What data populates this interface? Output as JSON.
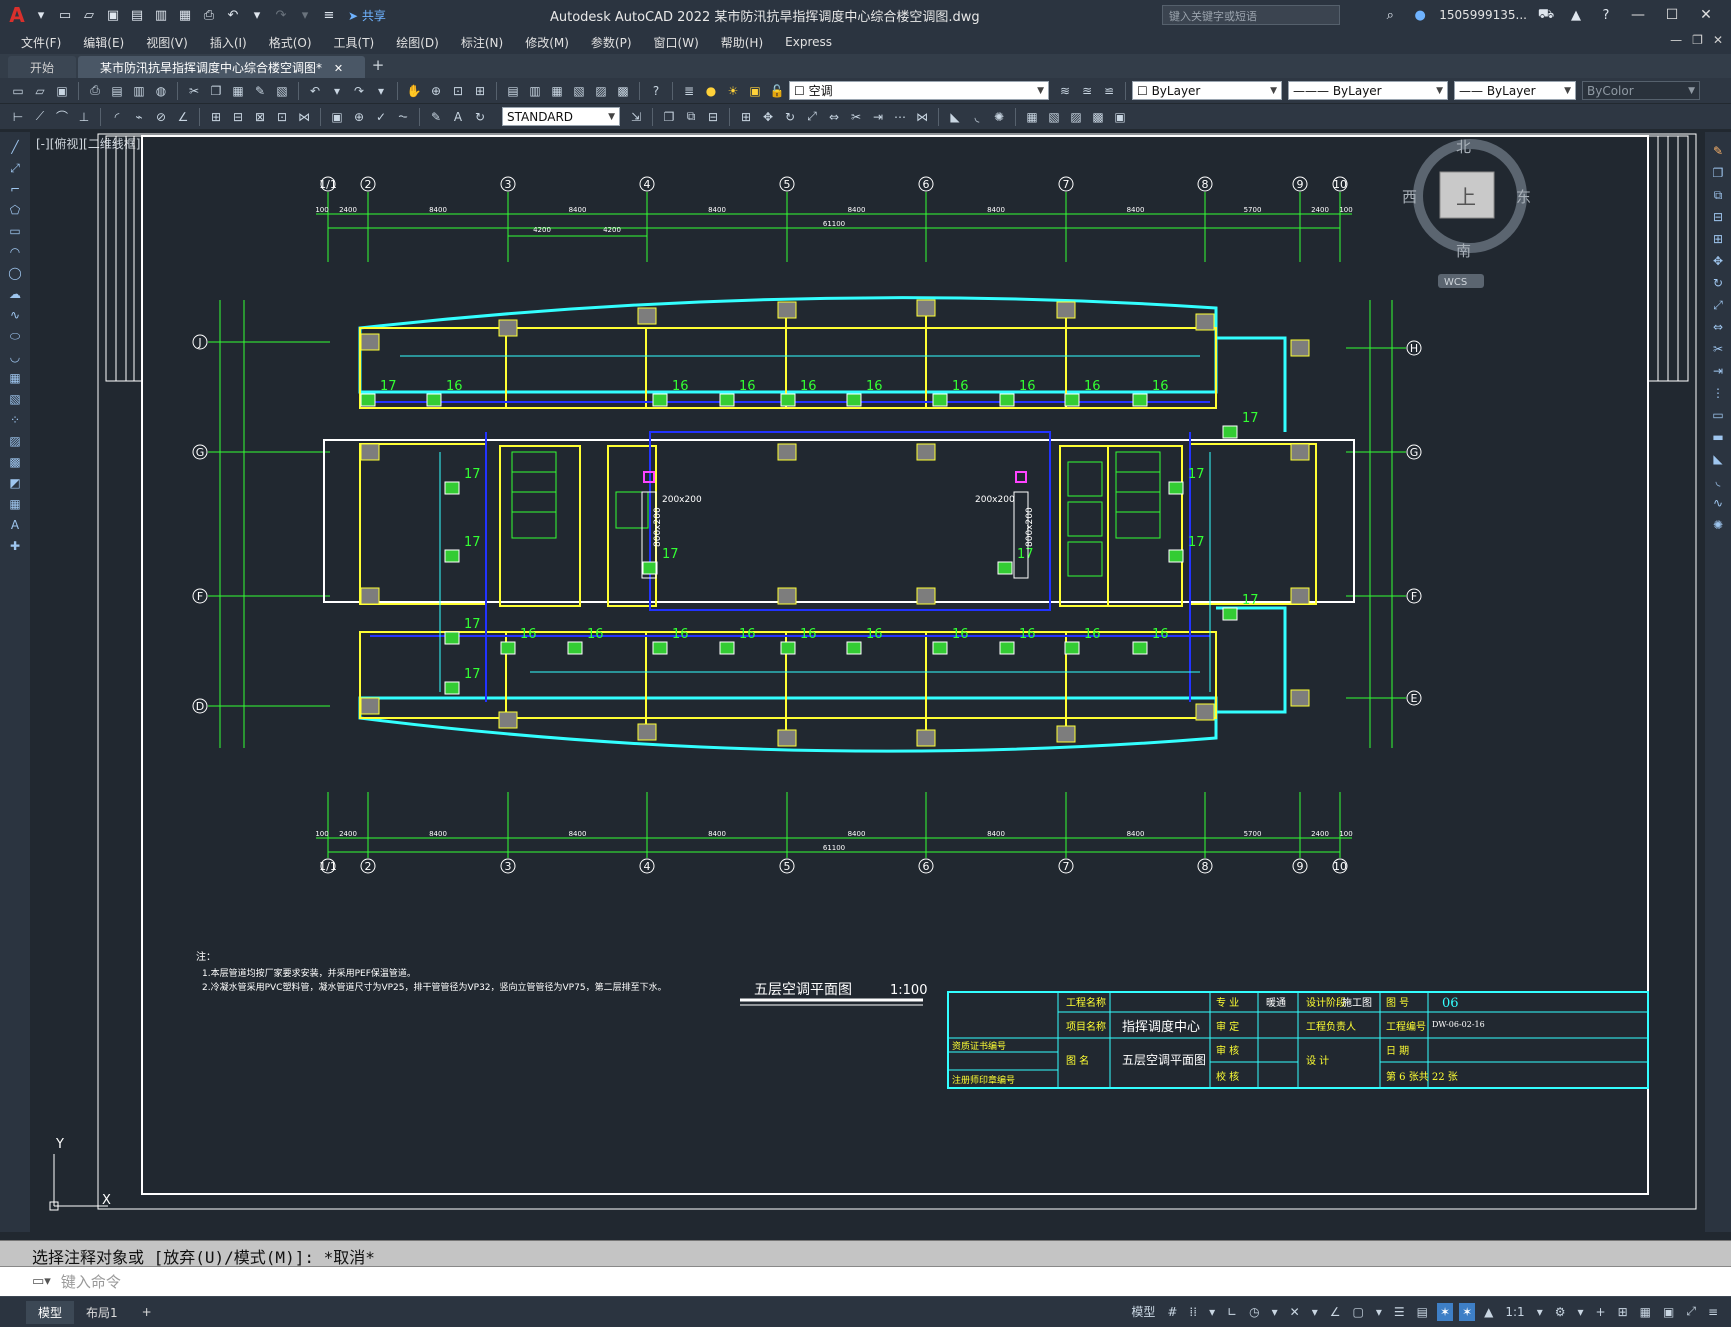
{
  "app": {
    "logo": "A",
    "title": "Autodesk AutoCAD 2022    某市防汛抗旱指挥调度中心综合楼空调图.dwg",
    "share": "共享",
    "search_placeholder": "键入关键字或短语",
    "user": "1505999135...",
    "minimize": "—",
    "maximize": "☐",
    "close": "✕"
  },
  "menu": [
    "文件(F)",
    "编辑(E)",
    "视图(V)",
    "插入(I)",
    "格式(O)",
    "工具(T)",
    "绘图(D)",
    "标注(N)",
    "修改(M)",
    "参数(P)",
    "窗口(W)",
    "帮助(H)",
    "Express"
  ],
  "tabs": {
    "start": "开始",
    "drawing": "某市防汛抗旱指挥调度中心综合楼空调图*",
    "close": "✕",
    "add": "+"
  },
  "properties": {
    "layer": "空调",
    "color": "ByLayer",
    "linetype": "ByLayer",
    "lineweight": "ByLayer",
    "plotstyle": "ByColor",
    "text_style": "STANDARD"
  },
  "viewport": {
    "label": "[-][俯视][二维线框]",
    "viewcube": {
      "north": "北",
      "south": "南",
      "east": "东",
      "west": "西",
      "top": "上",
      "wcs": "WCS"
    },
    "ucs_y": "Y",
    "ucs_x": "X"
  },
  "drawing": {
    "grid_top": [
      "1/1",
      "2",
      "3",
      "4",
      "5",
      "6",
      "7",
      "8",
      "9",
      "10"
    ],
    "grid_left": [
      "J",
      "G",
      "F",
      "D"
    ],
    "grid_right": [
      "H",
      "G",
      "F",
      "E"
    ],
    "dims_top": [
      "100",
      "2400",
      "8400",
      "8400",
      "8400",
      "8400",
      "8400",
      "8400",
      "5700",
      "2400",
      "100"
    ],
    "dim_total": "61100",
    "dim_sub": [
      "4200",
      "4200"
    ],
    "unit_labels": [
      "16",
      "17"
    ],
    "duct_sizes": [
      "200x200",
      "800x200"
    ],
    "plan_title": "五层空调平面图",
    "plan_scale": "1:100",
    "notes_title": "注：",
    "notes": [
      "1.本层管道均按厂家要求安装，并采用PEF保温管道。",
      "2.冷凝水管采用PVC塑料管，凝水管道尺寸为VP25，排干管管径为VP32，竖向立管管径为VP75，第二层排至下水。"
    ]
  },
  "titleblock": {
    "project_name_label": "工程名称",
    "item_name_label": "项目名称",
    "item_name": "指挥调度中心",
    "drawing_name_label": "图  名",
    "drawing_name": "五层空调平面图",
    "cert_label": "资质证书编号",
    "reg_label": "注册师印章编号",
    "major_label": "专  业",
    "major": "暖通",
    "stage_label": "设计阶段",
    "stage": "施工图",
    "sheet_label": "图  号",
    "sheet": "06",
    "approve_label": "审  定",
    "leader_label": "工程负责人",
    "proj_no_label": "工程编号",
    "proj_no": "DW-06-02-16",
    "review_label": "审  核",
    "design_label": "设  计",
    "date_label": "日  期",
    "check_label": "校  核",
    "page": "第 6  张共 22  张"
  },
  "command": {
    "history": "选择注释对象或 [放弃(U)/模式(M)]: *取消*",
    "placeholder": "键入命令"
  },
  "status": {
    "model_tab": "模型",
    "layout_tab": "布局1",
    "add": "+",
    "model": "模型",
    "scale": "1:1"
  },
  "colors": {
    "wall": "#ffff33",
    "grid": "#33ff33",
    "outline": "#33ffff",
    "duct": "#2233ff",
    "column": "#7d7d7d"
  }
}
